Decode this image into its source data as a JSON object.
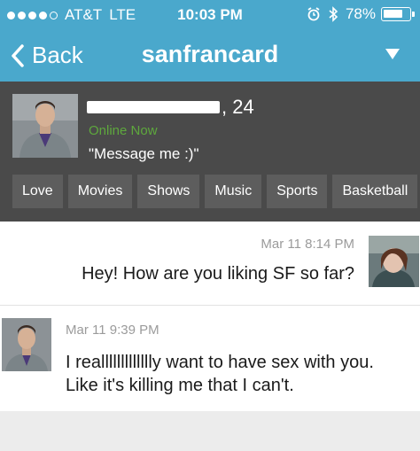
{
  "status_bar": {
    "carrier": "AT&T",
    "network": "LTE",
    "time": "10:03 PM",
    "battery_percent": "78%",
    "battery_level": 0.78,
    "icons": [
      "signal-dots-icon",
      "alarm-icon",
      "bluetooth-icon",
      "battery-icon"
    ]
  },
  "nav": {
    "back_label": "Back",
    "title": "sanfrancard"
  },
  "profile": {
    "age_suffix": ", 24",
    "status": "Online Now",
    "tagline": "\"Message me :)\"",
    "interests": [
      "Love",
      "Movies",
      "Shows",
      "Music",
      "Sports",
      "Basketball"
    ]
  },
  "messages": [
    {
      "timestamp": "Mar 11 8:14 PM",
      "text": "Hey! How are you liking SF so far?"
    },
    {
      "timestamp": "Mar 11 9:39 PM",
      "text": "I reallllllllllllly want to have sex with you. Like it's killing me that I can't."
    }
  ],
  "colors": {
    "header_blue": "#4aa8cc",
    "profile_bg": "#4a4a4a",
    "tag_bg": "#5d5d5d",
    "online_green": "#5ea83d",
    "timestamp_gray": "#9b9b9b"
  }
}
